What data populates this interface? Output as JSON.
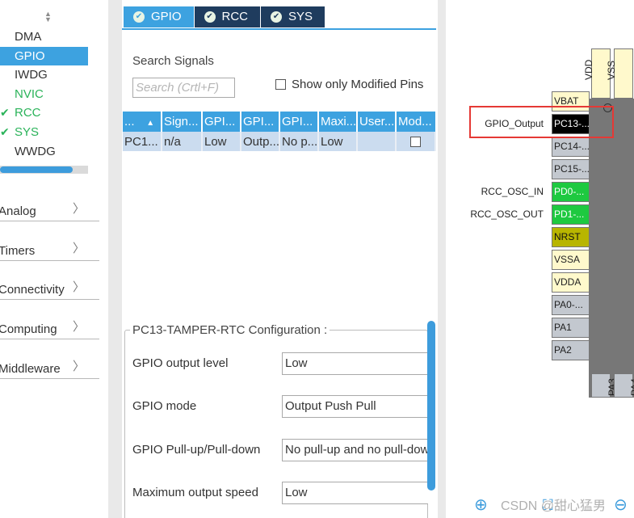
{
  "sidebar": {
    "sort_icon": "sort-arrows-icon",
    "peripherals": [
      {
        "label": "DMA",
        "state": "normal"
      },
      {
        "label": "GPIO",
        "state": "selected"
      },
      {
        "label": "IWDG",
        "state": "normal"
      },
      {
        "label": "NVIC",
        "state": "green"
      },
      {
        "label": "RCC",
        "state": "checked"
      },
      {
        "label": "SYS",
        "state": "checked"
      },
      {
        "label": "WWDG",
        "state": "normal"
      }
    ],
    "categories": [
      {
        "label": "Analog"
      },
      {
        "label": "Timers"
      },
      {
        "label": "Connectivity"
      },
      {
        "label": "Computing"
      },
      {
        "label": "Middleware"
      }
    ]
  },
  "tabs": [
    {
      "label": "GPIO",
      "active": true
    },
    {
      "label": "RCC",
      "active": false
    },
    {
      "label": "SYS",
      "active": false
    }
  ],
  "search": {
    "label": "Search Signals",
    "placeholder": "Search (Crtl+F)",
    "modified_only_label": "Show only Modified Pins"
  },
  "signals_table": {
    "headers": [
      "...",
      "Sign...",
      "GPI...",
      "GPI...",
      "GPI...",
      "Maxi...",
      "User...",
      "Mod..."
    ],
    "rows": [
      [
        "PC1...",
        "n/a",
        "Low",
        "Outp...",
        "No p...",
        "Low",
        "",
        ""
      ]
    ]
  },
  "config": {
    "title": "PC13-TAMPER-RTC Configuration :",
    "rows": [
      {
        "label": "GPIO output level",
        "value": "Low"
      },
      {
        "label": "GPIO mode",
        "value": "Output Push Pull"
      },
      {
        "label": "GPIO Pull-up/Pull-down",
        "value": "No pull-up and no pull-dow"
      },
      {
        "label": "Maximum output speed",
        "value": "Low"
      }
    ]
  },
  "chip": {
    "top_pins": [
      "VDD",
      "VSS"
    ],
    "left_pins": [
      {
        "label": "VBAT",
        "color": "yellow",
        "signal": ""
      },
      {
        "label": "PC13-...",
        "color": "black",
        "signal": "GPIO_Output"
      },
      {
        "label": "PC14-...",
        "color": "gray",
        "signal": ""
      },
      {
        "label": "PC15-...",
        "color": "gray",
        "signal": ""
      },
      {
        "label": "PD0-...",
        "color": "green",
        "signal": "RCC_OSC_IN"
      },
      {
        "label": "PD1-...",
        "color": "green",
        "signal": "RCC_OSC_OUT"
      },
      {
        "label": "NRST",
        "color": "olive",
        "signal": ""
      },
      {
        "label": "VSSA",
        "color": "yellow",
        "signal": ""
      },
      {
        "label": "VDDA",
        "color": "yellow",
        "signal": ""
      },
      {
        "label": "PA0-...",
        "color": "gray",
        "signal": ""
      },
      {
        "label": "PA1",
        "color": "gray",
        "signal": ""
      },
      {
        "label": "PA2",
        "color": "gray",
        "signal": ""
      }
    ],
    "bottom_pins": [
      "PA3",
      "PA4"
    ],
    "watermark": "CSDN @甜心猛男"
  },
  "colors": {
    "accent": "#3da2e0",
    "tab_dark": "#1f3c5e",
    "ok_green": "#2bb35a",
    "highlight_red": "#e53935"
  }
}
